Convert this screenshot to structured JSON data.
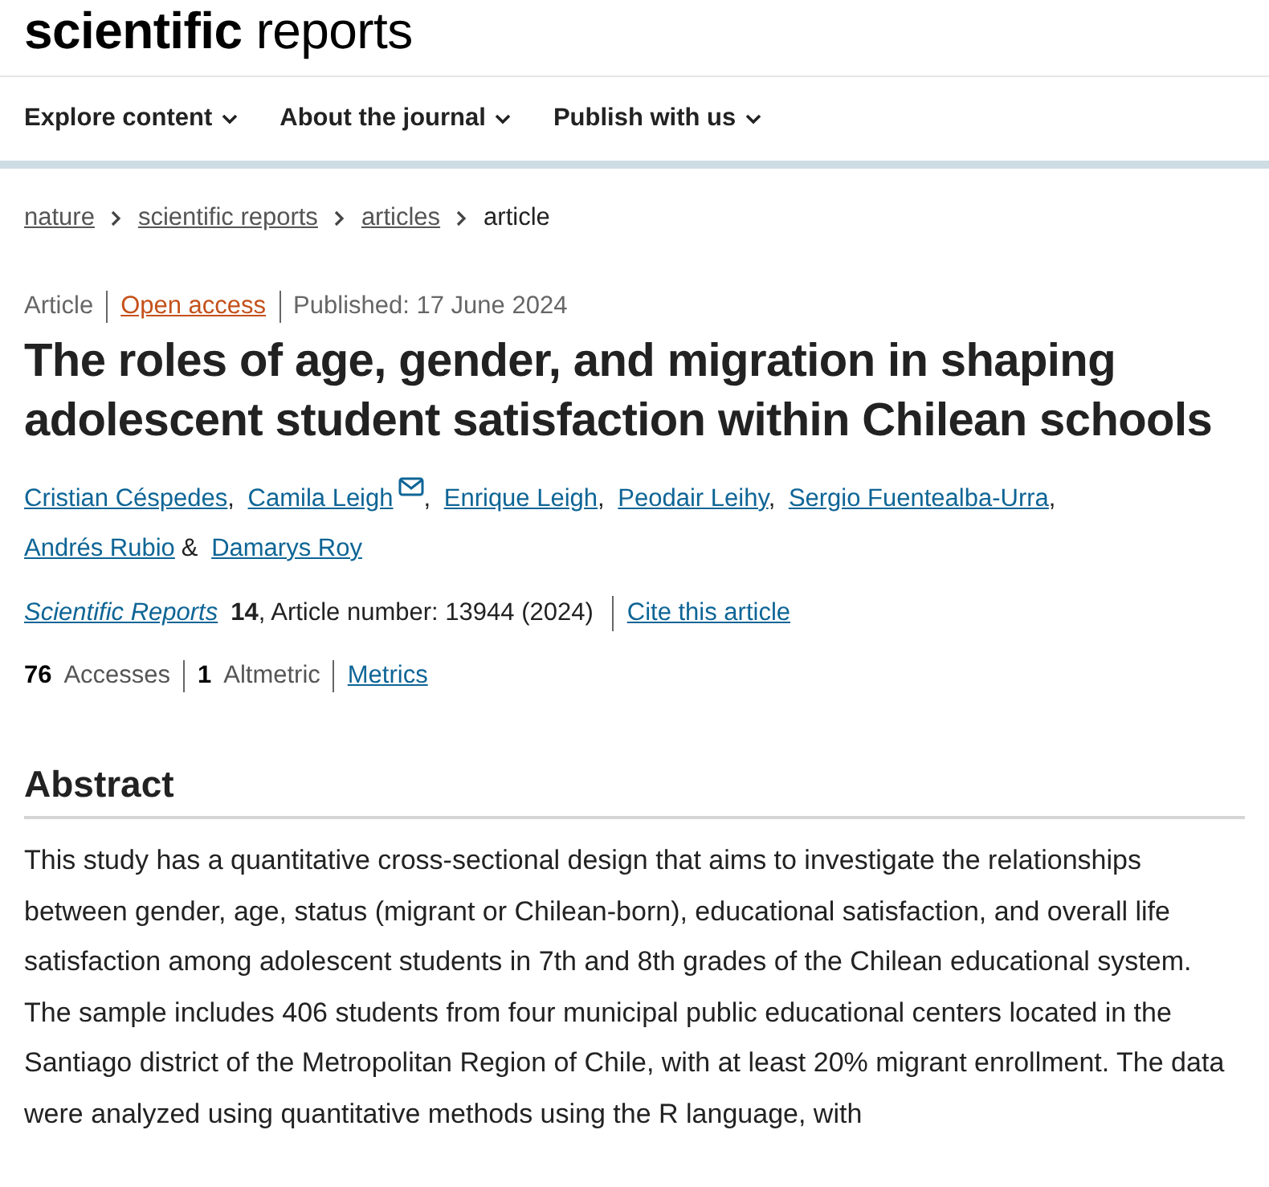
{
  "logo": "**scientific** reports",
  "nav": [
    {
      "label": "Explore content"
    },
    {
      "label": "About the journal"
    },
    {
      "label": "Publish with us"
    }
  ],
  "breadcrumbs": [
    {
      "label": "nature",
      "current": false
    },
    {
      "label": "scientific reports",
      "current": false
    },
    {
      "label": "articles",
      "current": false
    },
    {
      "label": "article",
      "current": true
    }
  ],
  "meta": [
    {
      "kind": "text",
      "text": "Article"
    },
    {
      "kind": "link",
      "text": "Open access"
    },
    {
      "kind": "text",
      "text": "Published: 17 June 2024"
    }
  ],
  "title": "The roles of age, gender, and migration in shaping adolescent student satisfaction within Chilean schools",
  "authors": [
    {
      "name": "Cristian Céspedes",
      "email": false,
      "after": ","
    },
    {
      "name": "Camila Leigh",
      "email": true,
      "after": ","
    },
    {
      "name": "Enrique Leigh",
      "email": false,
      "after": ","
    },
    {
      "name": "Peodair Leihy",
      "email": false,
      "after": ","
    },
    {
      "name": "Sergio Fuentealba-Urra",
      "email": false,
      "after": ","
    },
    {
      "name": "Andrés Rubio",
      "email": false,
      "after": "&"
    },
    {
      "name": "Damarys Roy",
      "email": false
    }
  ],
  "citation": {
    "journal": "Scientific Reports",
    "details": "**14**, Article number: 13944 (2024)",
    "cite_link": "Cite this article"
  },
  "metrics": [
    {
      "kind": "text",
      "text": "**76** Accesses"
    },
    {
      "kind": "text",
      "text": "**1** Altmetric"
    },
    {
      "kind": "link",
      "text": "Metrics"
    }
  ],
  "abstract": {
    "heading": "Abstract",
    "text": "This study has a quantitative cross-sectional design that aims to investigate the relationships between gender, age, status (migrant or Chilean-born), educational satisfaction, and overall life satisfaction among adolescent students in 7th and 8th grades of the Chilean educational system. The sample includes 406 students from four municipal public educational centers located in the Santiago district of the Metropolitan Region of Chile, with at least 20% migrant enrollment. The data were analyzed using quantitative methods using the R language, with"
  }
}
